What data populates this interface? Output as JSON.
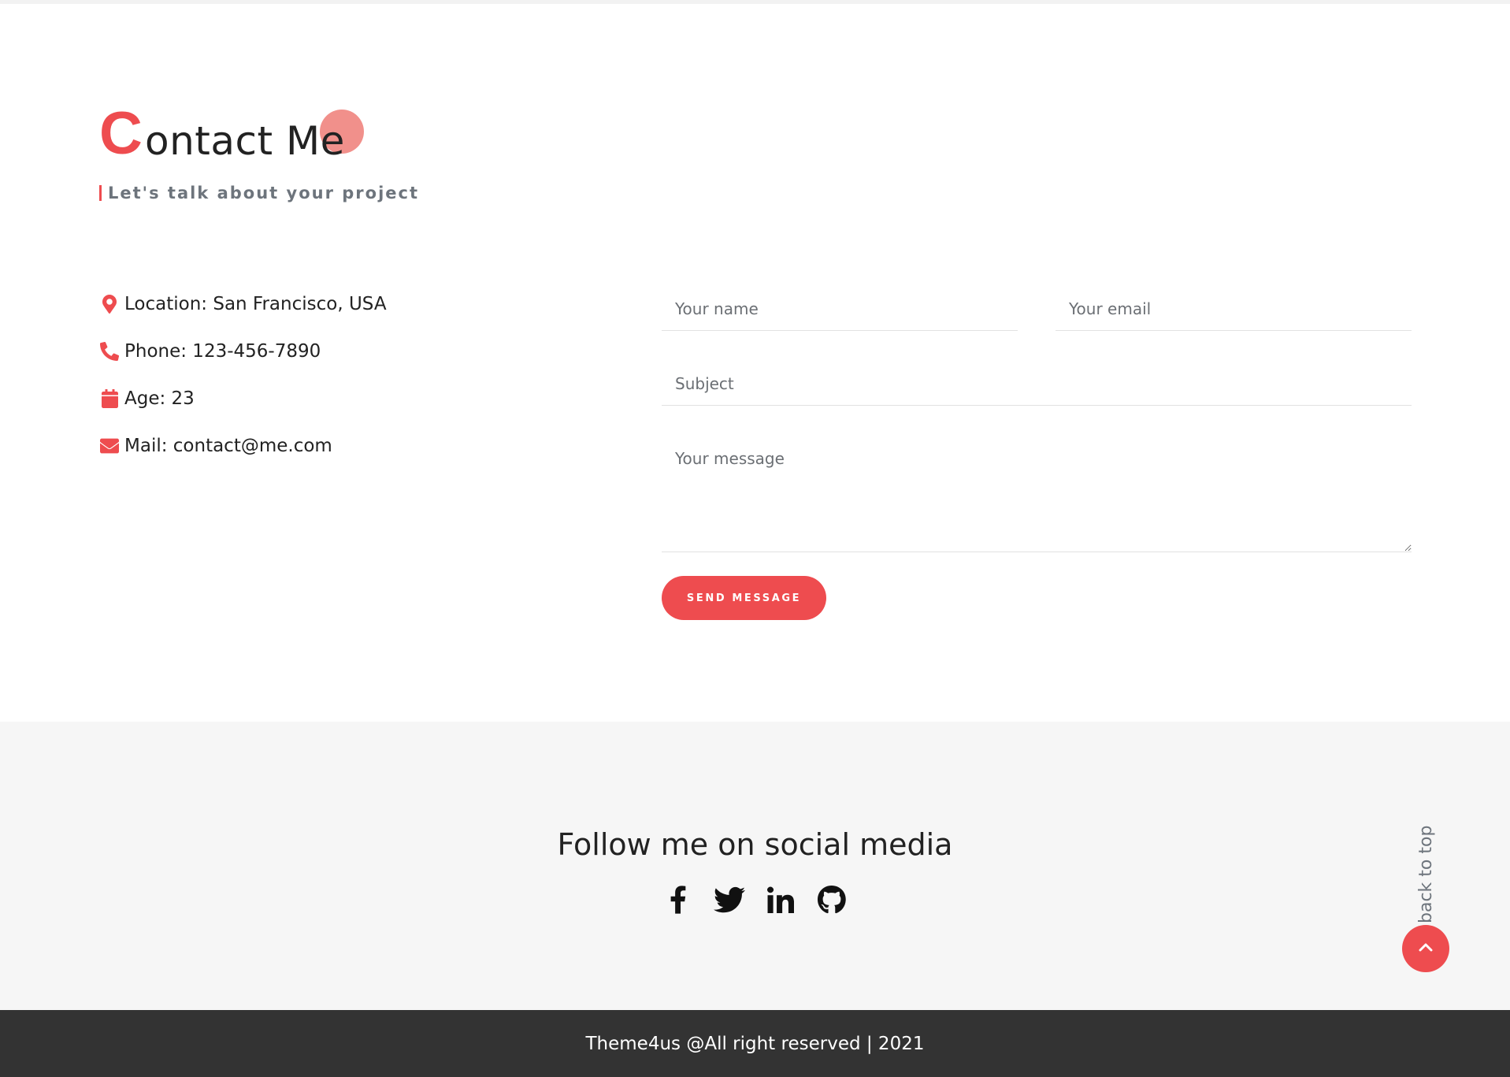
{
  "contact": {
    "heading_first_letter": "C",
    "heading_rest": "ontact Me",
    "subtitle": "Let's talk about your project",
    "info": [
      {
        "icon": "map-marker-icon",
        "text": "Location: San Francisco, USA"
      },
      {
        "icon": "phone-icon",
        "text": "Phone: 123-456-7890"
      },
      {
        "icon": "calendar-icon",
        "text": "Age: 23"
      },
      {
        "icon": "envelope-icon",
        "text": "Mail: contact@me.com"
      }
    ]
  },
  "form": {
    "name_placeholder": "Your name",
    "email_placeholder": "Your email",
    "subject_placeholder": "Subject",
    "message_placeholder": "Your message",
    "send_label": "SEND MESSAGE"
  },
  "social": {
    "title": "Follow me on social media",
    "icons": [
      "facebook-icon",
      "twitter-icon",
      "linkedin-icon",
      "github-icon"
    ]
  },
  "back_to_top": {
    "label": "back to top",
    "icon": "chevron-up-icon"
  },
  "footer": {
    "text": "Theme4us @All right reserved | 2021"
  },
  "colors": {
    "accent": "#ee4c4f",
    "accent_light": "#f08a85",
    "footer_bg": "#333333",
    "social_bg": "#f6f6f6",
    "muted_text": "#6d747c"
  }
}
